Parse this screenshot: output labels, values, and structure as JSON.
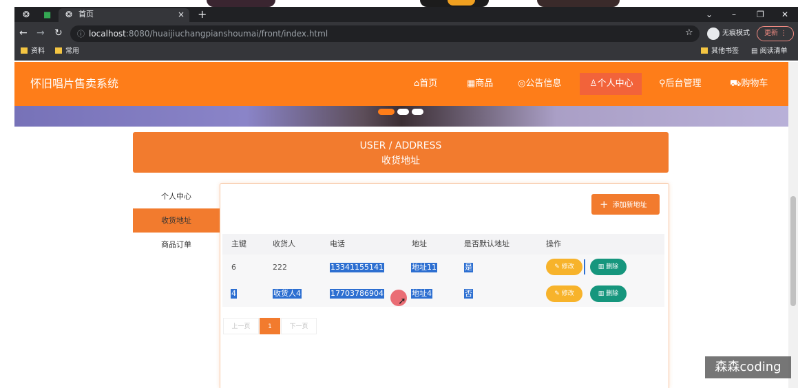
{
  "browser": {
    "tab_title": "首页",
    "tab_close": "×",
    "new_tab": "+",
    "url_host": "localhost",
    "url_path": ":8080/huaijiuchangpianshoumai/front/index.html",
    "incognito_label": "无痕模式",
    "update_label": "更新",
    "bookmarks": [
      "资料",
      "常用"
    ],
    "other_bookmarks": "其他书签",
    "reading_list": "阅读清单"
  },
  "site": {
    "logo": "怀旧唱片售卖系统",
    "nav": [
      "首页",
      "商品",
      "公告信息",
      "个人中心",
      "后台管理",
      "购物车"
    ],
    "active_nav": "个人中心"
  },
  "section": {
    "title_en": "USER / ADDRESS",
    "title_cn": "收货地址"
  },
  "sidebar": {
    "items": [
      "个人中心",
      "收货地址",
      "商品订单"
    ],
    "active": "收货地址"
  },
  "actions": {
    "add_label": "添加新地址",
    "edit_label": "修改",
    "delete_label": "删除"
  },
  "table": {
    "headers": [
      "主键",
      "收货人",
      "电话",
      "地址",
      "是否默认地址",
      "操作"
    ],
    "rows": [
      {
        "id": "6",
        "name": "222",
        "phone": "13341155141",
        "address": "地址11",
        "is_default": "是"
      },
      {
        "id": "4",
        "name": "收货人4",
        "phone": "17703786904",
        "address": "地址4",
        "is_default": "否"
      }
    ]
  },
  "pagination": {
    "prev": "上一页",
    "current": "1",
    "next": "下一页"
  },
  "watermark": "森森coding",
  "colors": {
    "brand": "#fe7d19",
    "accent": "#f27b2e",
    "edit": "#f7b32b",
    "delete": "#16967d"
  }
}
